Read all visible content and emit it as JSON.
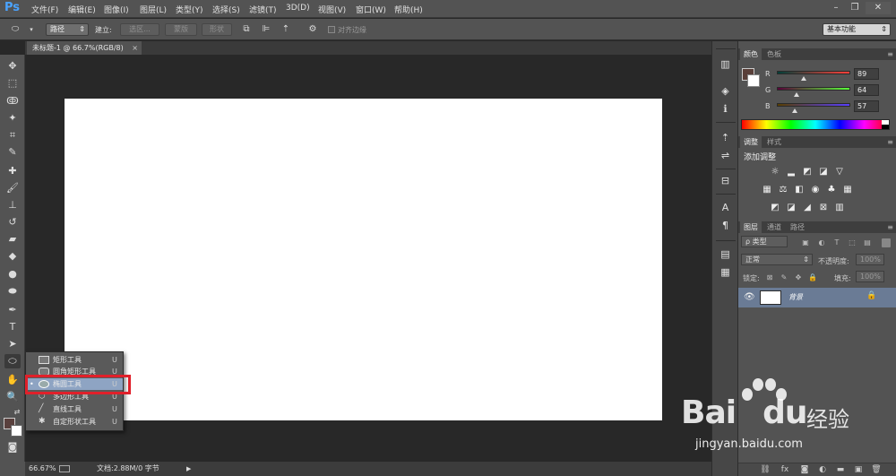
{
  "app": {
    "logo": "Ps",
    "menu": [
      "文件(F)",
      "编辑(E)",
      "图像(I)",
      "图层(L)",
      "类型(Y)",
      "选择(S)",
      "滤镜(T)",
      "3D(D)",
      "视图(V)",
      "窗口(W)",
      "帮助(H)"
    ],
    "window_controls": [
      "minimize",
      "restore",
      "close"
    ]
  },
  "options_bar": {
    "mode": "路径",
    "build_label": "建立:",
    "btn_selection": "选区...",
    "btn_mask": "蒙版",
    "btn_shape": "形状",
    "align_edges": "对齐边缘",
    "workspace": "基本功能"
  },
  "document": {
    "tab_title": "未标题-1 @ 66.7%(RGB/8)",
    "tab_close": "×",
    "zoom": "66.67%",
    "doc_info": "文档:2.88M/0 字节"
  },
  "flyout": {
    "items": [
      {
        "label": "矩形工具",
        "shortcut": "U",
        "icon": "rectangle-icon"
      },
      {
        "label": "圆角矩形工具",
        "shortcut": "U",
        "icon": "rounded-rectangle-icon"
      },
      {
        "label": "椭圆工具",
        "shortcut": "U",
        "icon": "ellipse-icon",
        "selected": true
      },
      {
        "label": "多边形工具",
        "shortcut": "U",
        "icon": "polygon-icon"
      },
      {
        "label": "直线工具",
        "shortcut": "U",
        "icon": "line-icon"
      },
      {
        "label": "自定形状工具",
        "shortcut": "U",
        "icon": "custom-shape-icon"
      }
    ]
  },
  "color_panel": {
    "tabs": [
      "颜色",
      "色板"
    ],
    "r": {
      "label": "R",
      "value": "89"
    },
    "g": {
      "label": "G",
      "value": "64"
    },
    "b": {
      "label": "B",
      "value": "57"
    },
    "fg_color": "#593f39"
  },
  "adjust_panel": {
    "tabs": [
      "调整",
      "样式"
    ],
    "title": "添加调整"
  },
  "layers_panel": {
    "tabs": [
      "图层",
      "通道",
      "路径"
    ],
    "filter": "ρ 类型",
    "blend_mode": "正常",
    "opacity_label": "不透明度:",
    "opacity_value": "100%",
    "lock_label": "锁定:",
    "fill_label": "填充:",
    "fill_value": "100%",
    "layer_name": "背景"
  },
  "watermark": {
    "logo": "Bai",
    "logo2": "du",
    "cn": "经验",
    "url": "jingyan.baidu.com"
  }
}
